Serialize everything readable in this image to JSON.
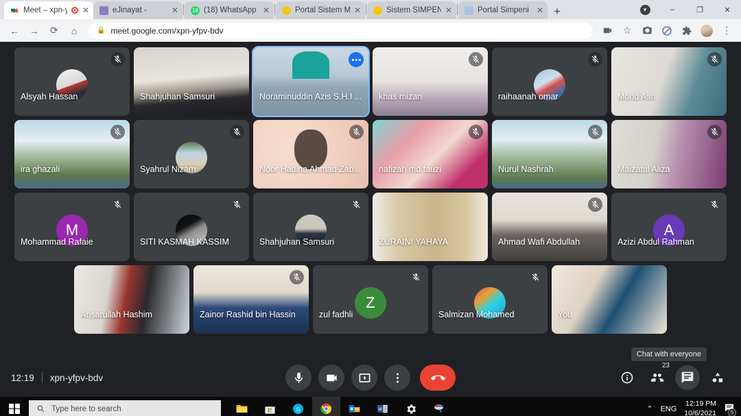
{
  "browser": {
    "tabs": [
      {
        "title": "Meet – xpn-yfp",
        "favicon": "meet-icon",
        "active": true,
        "recording": true
      },
      {
        "title": "eJinayat -",
        "favicon": "ejinayat-icon",
        "active": false
      },
      {
        "title": "(18) WhatsApp",
        "favicon": "whatsapp-icon",
        "active": false
      },
      {
        "title": "Portal Sistem Maklu",
        "favicon": "jata-icon",
        "active": false
      },
      {
        "title": "Sistem SIMPENI",
        "favicon": "jata-icon",
        "active": false
      },
      {
        "title": "Portal Simpeni",
        "favicon": "simpeni-icon",
        "active": false
      }
    ],
    "new_tab_label": "+",
    "window_controls": {
      "minimize": "–",
      "maximize": "❐",
      "close": "✕"
    },
    "toolbar": {
      "back": "←",
      "forward": "→",
      "reload": "⟳",
      "home": "⌂",
      "url": "meet.google.com/xpn-yfpv-bdv",
      "lock": "🔒",
      "icons": [
        "video-call-icon",
        "bookmark-star-icon",
        "screenshot-camera-icon",
        "block-icon",
        "extensions-puzzle-icon",
        "profile-avatar",
        "chrome-menu-icon"
      ]
    }
  },
  "meet": {
    "rows": [
      [
        {
          "name": "Alsyah Hassan",
          "muted": true,
          "kind": "avatar",
          "avatar_type": "photo",
          "photo": "photo-red-hijab",
          "bg": "#3c4043"
        },
        {
          "name": "Shahjuhan Samsuri",
          "muted": false,
          "kind": "video",
          "bg": "room-bright"
        },
        {
          "name": "Noraminuddin Azis S.H.I ...",
          "muted": false,
          "kind": "video",
          "bg": "city-teal",
          "spotlight": true,
          "menu": true
        },
        {
          "name": "khas mizan",
          "muted": true,
          "kind": "video",
          "bg": "room-white"
        },
        {
          "name": "raihaanah omar",
          "muted": true,
          "kind": "avatar",
          "avatar_type": "photo",
          "photo": "photo-family",
          "bg": "#3c4043"
        },
        {
          "name": "Mohd Asri",
          "muted": true,
          "kind": "video",
          "bg": "room-teal-curtain"
        }
      ],
      [
        {
          "name": "ira ghazali",
          "muted": true,
          "kind": "video",
          "bg": "mountains"
        },
        {
          "name": "Syahrul Nizam",
          "muted": true,
          "kind": "avatar",
          "avatar_type": "photo",
          "photo": "photo-landscape",
          "bg": "#3c4043"
        },
        {
          "name": "Noor Hadina Ahmad Zab...",
          "muted": true,
          "kind": "video",
          "bg": "peach-bokeh"
        },
        {
          "name": "nafizah md fauzi",
          "muted": true,
          "kind": "video",
          "bg": "floral"
        },
        {
          "name": "Nurul Nashrah",
          "muted": true,
          "kind": "video",
          "bg": "mountains"
        },
        {
          "name": "Maizatul Aliza",
          "muted": true,
          "kind": "video",
          "bg": "purple-curtain"
        }
      ],
      [
        {
          "name": "Mohammad Rafaie",
          "muted": true,
          "kind": "avatar",
          "avatar_type": "initial",
          "initial": "M",
          "avatar_color": "#9c27b0",
          "bg": "#3c4043"
        },
        {
          "name": "SITI KASMAH KASSIM",
          "muted": true,
          "kind": "avatar",
          "avatar_type": "photo",
          "photo": "photo-moon",
          "bg": "#3c4043"
        },
        {
          "name": "Shahjuhan Samsuri",
          "muted": true,
          "kind": "avatar",
          "avatar_type": "photo",
          "photo": "photo-suit",
          "bg": "#3c4043"
        },
        {
          "name": "ZURAINI YAHAYA",
          "muted": false,
          "kind": "video",
          "bg": "bookshelf"
        },
        {
          "name": "Ahmad Wafi Abdullah",
          "muted": true,
          "kind": "video",
          "bg": "cabinet"
        },
        {
          "name": "Azizi Abdul Rahman",
          "muted": true,
          "kind": "avatar",
          "avatar_type": "initial",
          "initial": "A",
          "avatar_color": "#673ab7",
          "bg": "#3c4043"
        }
      ],
      [
        {
          "name": "Ansarullah Hashim",
          "muted": false,
          "kind": "video",
          "bg": "room-light"
        },
        {
          "name": "Zainor Rashid bin Hassin",
          "muted": true,
          "kind": "video",
          "bg": "curtain-beige"
        },
        {
          "name": "zul fadhli",
          "muted": true,
          "kind": "avatar",
          "avatar_type": "initial",
          "initial": "Z",
          "avatar_color": "#3a8c3a",
          "bg": "#3c4043"
        },
        {
          "name": "Salmizan Mohamed",
          "muted": true,
          "kind": "avatar",
          "avatar_type": "photo",
          "photo": "photo-cyan-hijab",
          "bg": "#3c4043"
        },
        {
          "name": "You",
          "muted": false,
          "kind": "video",
          "bg": "shelf-room"
        }
      ]
    ],
    "bottom": {
      "time": "12:19",
      "meeting_code": "xpn-yfpv-bdv",
      "controls": [
        {
          "name": "microphone-button",
          "icon": "mic-icon"
        },
        {
          "name": "camera-button",
          "icon": "camera-icon"
        },
        {
          "name": "present-button",
          "icon": "present-screen-icon"
        },
        {
          "name": "more-options-button",
          "icon": "more-vertical-icon"
        },
        {
          "name": "leave-call-button",
          "icon": "hangup-icon"
        }
      ],
      "right_controls": [
        {
          "name": "meeting-details-button",
          "icon": "info-icon"
        },
        {
          "name": "participants-button",
          "icon": "people-icon",
          "badge": "23"
        },
        {
          "name": "chat-button",
          "icon": "chat-icon",
          "active": true
        },
        {
          "name": "activities-button",
          "icon": "activities-icon"
        }
      ],
      "tooltip": "Chat with everyone"
    }
  },
  "taskbar": {
    "search_placeholder": "Type here to search",
    "apps": [
      {
        "name": "file-explorer",
        "running": true
      },
      {
        "name": "microsoft-store",
        "running": false
      },
      {
        "name": "skype",
        "running": true
      },
      {
        "name": "google-chrome",
        "running": true,
        "focused": true
      },
      {
        "name": "outlook",
        "running": true
      },
      {
        "name": "word",
        "running": true
      },
      {
        "name": "settings",
        "running": true
      },
      {
        "name": "paint",
        "running": true
      }
    ],
    "tray": {
      "chevron": "⌃",
      "language": "ENG",
      "time": "12:19 PM",
      "date": "10/6/2021",
      "notification_count": "5"
    }
  }
}
